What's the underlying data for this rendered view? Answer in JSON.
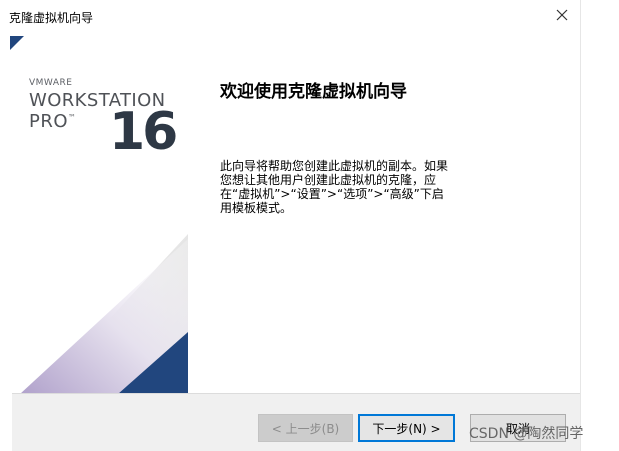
{
  "window": {
    "title": "克隆虚拟机向导",
    "close_symbol": "✕"
  },
  "brand": {
    "sub_label": "VMWARE",
    "main_label": "WORKSTATION",
    "edition_label": "PRO",
    "trademark": "™",
    "version": "16"
  },
  "content": {
    "heading": "欢迎使用克隆虚拟机向导",
    "description": "此向导将帮助您创建此虚拟机的副本。如果您想让其他用户创建此虚拟机的克隆，应在“虚拟机”>“设置”>“选项”>“高级”下启用模板模式。"
  },
  "buttons": {
    "back": "< 上一步(B)",
    "next": "下一步(N) >",
    "cancel": "取消"
  },
  "watermark": "CSDN @陶然同学",
  "colors": {
    "accent_blue": "#21467e",
    "focus_border": "#0078d7"
  }
}
